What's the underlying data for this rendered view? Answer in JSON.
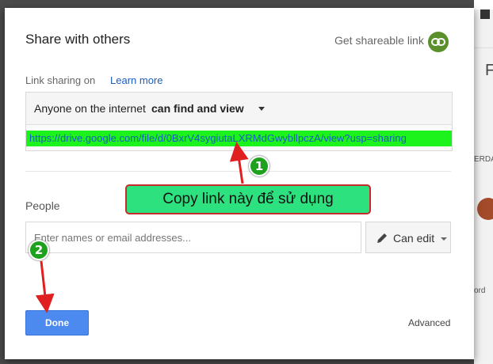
{
  "dialog": {
    "title": "Share with others",
    "get_link_label": "Get shareable link",
    "link_sharing_label": "Link sharing on",
    "learn_more": "Learn more",
    "sharing_option_prefix": "Anyone on the internet",
    "sharing_option_access": "can find and view",
    "share_url": "https://drive.google.com/file/d/0BxrV4sygiutaLXRMdGwybllpczA/view?usp=sharing",
    "people_label": "People",
    "people_placeholder": "Enter names or email addresses...",
    "permission_label": "Can edit",
    "done_label": "Done",
    "advanced_label": "Advanced"
  },
  "annotations": {
    "callout_text": "Copy link này để sử dụng",
    "step1": "1",
    "step2": "2"
  },
  "background": {
    "heading_letter": "F",
    "text_fragment_1": "ERDA",
    "text_fragment_2": "ord"
  },
  "colors": {
    "url_highlight": "#1cf31c",
    "callout_bg": "#2de27e",
    "callout_border": "#c62a2a",
    "badge": "#1ea21e",
    "arrow": "#e02020",
    "done_button": "#4d8af0",
    "link_icon_bg": "#5a8f2c"
  },
  "icons": {
    "link": "link-icon",
    "pencil": "pencil-icon",
    "caret": "caret-down-icon"
  }
}
